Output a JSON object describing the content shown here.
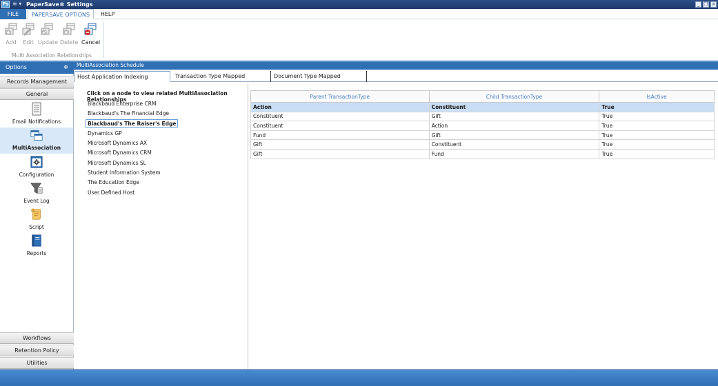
{
  "app": {
    "icon_text": "Ps",
    "title": "PaperSave® Settings",
    "quick_access": "≡ ▾"
  },
  "window_controls": {
    "minimize": "_",
    "restore": "❐",
    "close": "×"
  },
  "menu": {
    "file": "FILE",
    "papersave_options": "PAPERSAVE OPTIONS",
    "help": "HELP"
  },
  "ribbon": {
    "buttons": [
      {
        "label": "Add",
        "icon": "add-icon",
        "enabled": false
      },
      {
        "label": "Edit",
        "icon": "edit-icon",
        "enabled": false
      },
      {
        "label": "Update",
        "icon": "update-icon",
        "enabled": false
      },
      {
        "label": "Delete",
        "icon": "delete-icon",
        "enabled": false
      },
      {
        "label": "Cancel",
        "icon": "cancel-icon",
        "enabled": true
      }
    ],
    "group_label": "Multi Association Relationships"
  },
  "left_panel": {
    "header": "Options",
    "pin": "❉",
    "categories_top": [
      "Records Management",
      "General"
    ],
    "nav_items": [
      {
        "label": "Email Notifications",
        "icon": "document-icon",
        "selected": false
      },
      {
        "label": "MultiAssociation",
        "icon": "windows-icon",
        "selected": true
      },
      {
        "label": "Configuration",
        "icon": "gear-icon",
        "selected": false
      },
      {
        "label": "Event Log",
        "icon": "filter-icon",
        "selected": false
      },
      {
        "label": "Script",
        "icon": "scroll-icon",
        "selected": false
      },
      {
        "label": "Reports",
        "icon": "book-icon",
        "selected": false
      }
    ],
    "categories_bottom": [
      "Workflows",
      "Retention Policy",
      "Utilities"
    ]
  },
  "schedule_header": "MultiAssociation Schedule",
  "tabs": [
    {
      "label": "Host Application Indexing Association",
      "active": true
    },
    {
      "label": "Transaction Type Mapped Association",
      "active": false
    },
    {
      "label": "Document Type Mapped Association",
      "active": false
    }
  ],
  "tree": {
    "hint": "Click on a node to view related MultiAssociation Relationships",
    "nodes": [
      "Blackbaud Enterprise CRM",
      "Blackbaud's The Financial Edge",
      "Blackbaud's The Raiser's Edge",
      "Dynamics GP",
      "Microsoft Dynamics AX",
      "Microsoft Dynamics CRM",
      "Microsoft Dynamics SL",
      "Student Information System",
      "The Education Edge",
      "User Defined Host"
    ],
    "selected_index": 2
  },
  "grid": {
    "columns": [
      "Parent TransactionType",
      "Child TransactionType",
      "IsActive"
    ],
    "rows": [
      [
        "Action",
        "Constituent",
        "True"
      ],
      [
        "Constituent",
        "Gift",
        "True"
      ],
      [
        "Constituent",
        "Action",
        "True"
      ],
      [
        "Fund",
        "Gift",
        "True"
      ],
      [
        "Gift",
        "Constituent",
        "True"
      ],
      [
        "Gift",
        "Fund",
        "True"
      ]
    ],
    "selected_row": 0
  },
  "colors": {
    "accent": "#2f6fb4",
    "selection": "#c9def5",
    "title_bar": "#1d3a6e"
  }
}
